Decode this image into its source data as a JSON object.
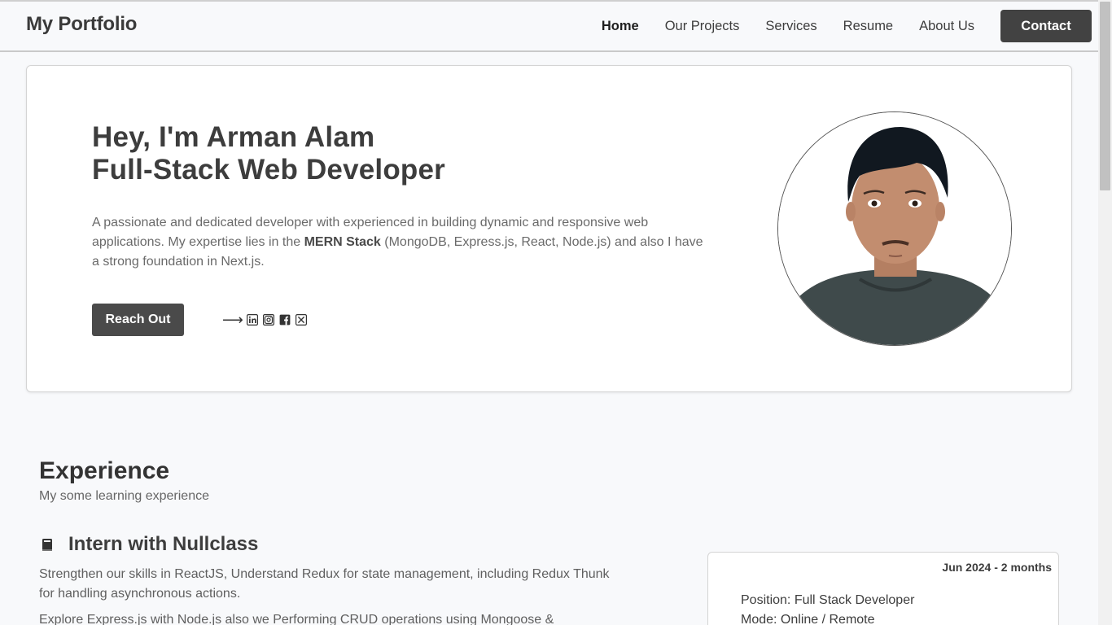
{
  "header": {
    "brand": "My Portfolio",
    "nav": [
      "Home",
      "Our Projects",
      "Services",
      "Resume",
      "About Us"
    ],
    "active": "Home",
    "contact_label": "Contact"
  },
  "hero": {
    "title_line1": "Hey, I'm Arman Alam",
    "title_line2": "Full-Stack Web Developer",
    "desc_before": "A passionate and dedicated developer with experienced in building dynamic and responsive web applications. My expertise lies in the ",
    "desc_bold": "MERN Stack",
    "desc_after": " (MongoDB, Express.js, React, Node.js) and also I have a strong foundation in Next.js.",
    "cta_label": "Reach Out",
    "arrow": "⟶",
    "socials": [
      "linkedin-icon",
      "instagram-icon",
      "facebook-icon",
      "x-icon"
    ]
  },
  "experience": {
    "title": "Experience",
    "subtitle": "My some learning experience",
    "job": {
      "icon": "book-icon",
      "title": "Intern with Nullclass",
      "desc1": "Strengthen our skills in ReactJS, Understand Redux for state management, including Redux Thunk for handling asynchronous actions.",
      "desc2": "Explore Express.js with Node.js also we Performing CRUD operations using Mongoose &",
      "date": "Jun 2024 - 2 months",
      "position": "Position: Full Stack Developer",
      "mode": "Mode: Online / Remote"
    }
  }
}
